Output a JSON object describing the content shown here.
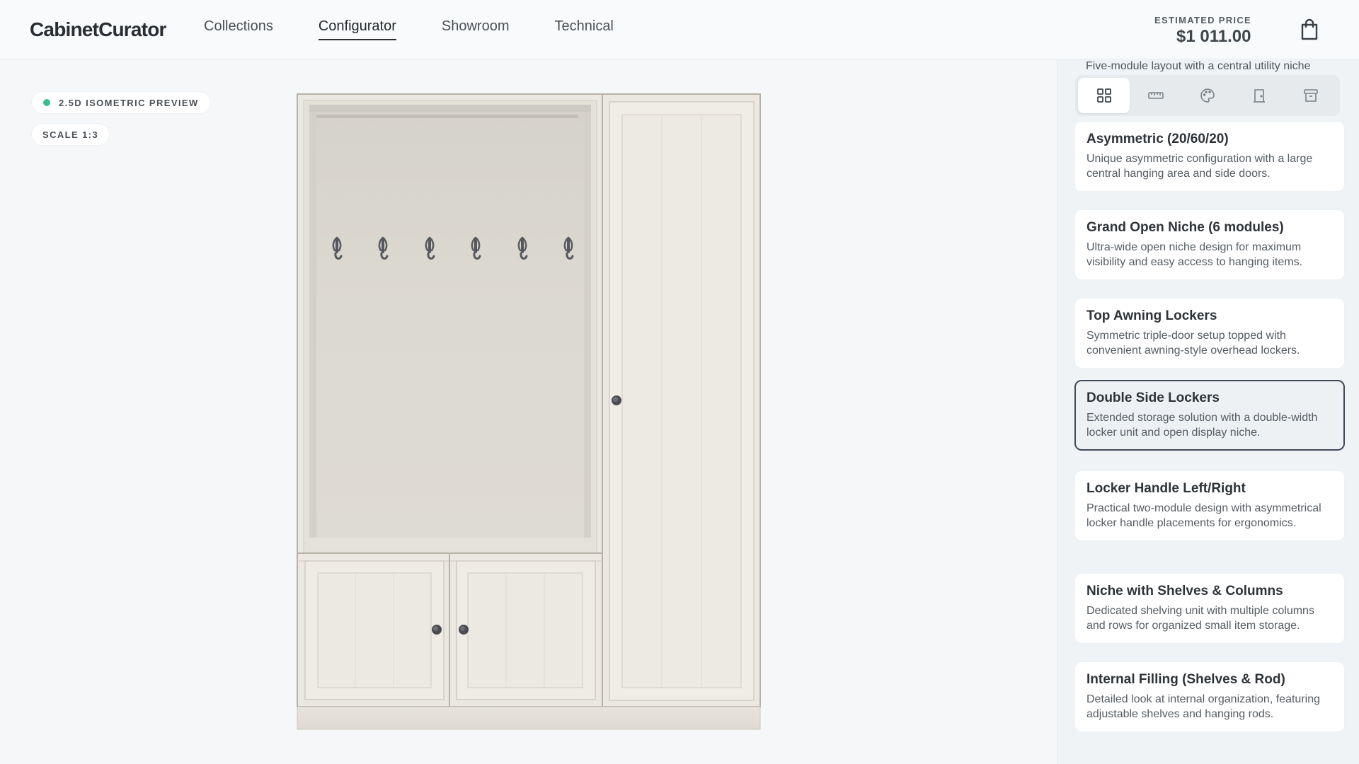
{
  "header": {
    "logo": "CabinetCurator",
    "nav": [
      "Collections",
      "Configurator",
      "Showroom",
      "Technical"
    ],
    "active_nav": "Configurator",
    "price_label": "ESTIMATED PRICE",
    "price_value": "$1 011.00"
  },
  "preview": {
    "mode_label": "2.5D ISOMETRIC PREVIEW",
    "scale_label": "SCALE 1:3",
    "status_color": "#3bbf8e",
    "hook_count": 6
  },
  "panel": {
    "partial_description": "Five-module layout with a central utility niche",
    "toolbar": [
      {
        "icon": "grid-icon",
        "active": true
      },
      {
        "icon": "ruler-icon",
        "active": false
      },
      {
        "icon": "palette-icon",
        "active": false
      },
      {
        "icon": "door-icon",
        "active": false
      },
      {
        "icon": "archive-icon",
        "active": false
      }
    ],
    "layouts": [
      {
        "title": "Asymmetric (20/60/20)",
        "description": "Unique asymmetric configuration with a large central hanging area and side doors.",
        "selected": false
      },
      {
        "title": "Grand Open Niche (6 modules)",
        "description": "Ultra-wide open niche design for maximum visibility and easy access to hanging items.",
        "selected": false
      },
      {
        "title": "Top Awning Lockers",
        "description": "Symmetric triple-door setup topped with convenient awning-style overhead lockers.",
        "selected": false
      },
      {
        "title": "Double Side Lockers",
        "description": "Extended storage solution with a double-width locker unit and open display niche.",
        "selected": true
      },
      {
        "title": "Locker Handle Left/Right",
        "description": "Practical two-module design with asymmetrical locker handle placements for ergonomics.",
        "selected": false
      },
      {
        "title": "Niche with Shelves & Columns",
        "description": "Dedicated shelving unit with multiple columns and rows for organized small item storage.",
        "selected": false
      },
      {
        "title": "Internal Filling (Shelves & Rod)",
        "description": "Detailed look at internal organization, featuring adjustable shelves and hanging rods.",
        "selected": false
      }
    ]
  }
}
